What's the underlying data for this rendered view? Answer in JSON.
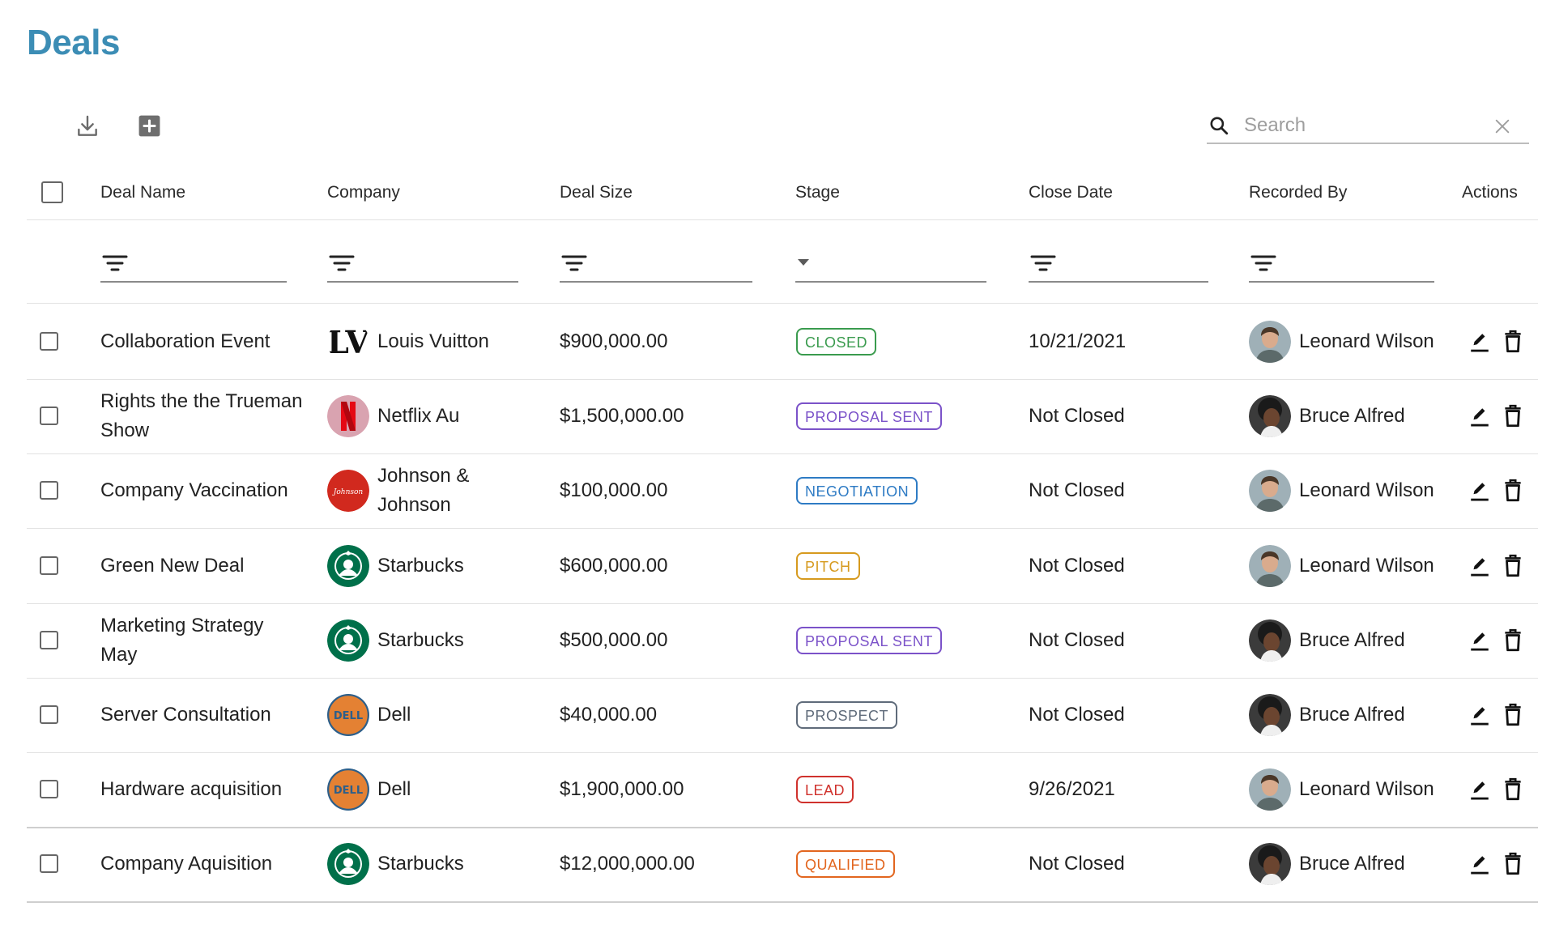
{
  "page": {
    "title": "Deals"
  },
  "toolbar": {
    "download_icon": "download-icon",
    "add_icon": "add-box-icon"
  },
  "search": {
    "placeholder": "Search",
    "value": "",
    "search_icon": "search-icon",
    "clear_icon": "close-icon"
  },
  "table": {
    "columns": [
      "Deal Name",
      "Company",
      "Deal Size",
      "Stage",
      "Close Date",
      "Recorded By",
      "Actions"
    ],
    "rows": [
      {
        "deal_name": "Collaboration Event",
        "company": "Louis Vuitton",
        "logo": "louis-vuitton-logo",
        "deal_size": "$900,000.00",
        "stage": "CLOSED",
        "stage_color": "#3a9b4e",
        "close_date": "10/21/2021",
        "recorded_by": "Leonard Wilson",
        "avatar": "leonard-avatar"
      },
      {
        "deal_name": "Rights the the Trueman Show",
        "company": "Netflix Au",
        "logo": "netflix-logo",
        "deal_size": "$1,500,000.00",
        "stage": "PROPOSAL SENT",
        "stage_color": "#7b52c9",
        "close_date": "Not Closed",
        "recorded_by": "Bruce Alfred",
        "avatar": "bruce-avatar"
      },
      {
        "deal_name": "Company Vaccination",
        "company": "Johnson & Johnson",
        "logo": "johnson-logo",
        "deal_size": "$100,000.00",
        "stage": "NEGOTIATION",
        "stage_color": "#2e7bc4",
        "close_date": "Not Closed",
        "recorded_by": "Leonard Wilson",
        "avatar": "leonard-avatar"
      },
      {
        "deal_name": "Green New Deal",
        "company": "Starbucks",
        "logo": "starbucks-logo",
        "deal_size": "$600,000.00",
        "stage": "PITCH",
        "stage_color": "#d69a1e",
        "close_date": "Not Closed",
        "recorded_by": "Leonard Wilson",
        "avatar": "leonard-avatar"
      },
      {
        "deal_name": "Marketing Strategy May",
        "company": "Starbucks",
        "logo": "starbucks-logo",
        "deal_size": "$500,000.00",
        "stage": "PROPOSAL SENT",
        "stage_color": "#7b52c9",
        "close_date": "Not Closed",
        "recorded_by": "Bruce Alfred",
        "avatar": "bruce-avatar"
      },
      {
        "deal_name": "Server Consultation",
        "company": "Dell",
        "logo": "dell-logo",
        "deal_size": "$40,000.00",
        "stage": "PROSPECT",
        "stage_color": "#5f6b7a",
        "close_date": "Not Closed",
        "recorded_by": "Bruce Alfred",
        "avatar": "bruce-avatar"
      },
      {
        "deal_name": "Hardware acquisition",
        "company": "Dell",
        "logo": "dell-logo",
        "deal_size": "$1,900,000.00",
        "stage": "LEAD",
        "stage_color": "#d0322d",
        "close_date": "9/26/2021",
        "recorded_by": "Leonard Wilson",
        "avatar": "leonard-avatar"
      },
      {
        "deal_name": "Company Aquisition",
        "company": "Starbucks",
        "logo": "starbucks-logo",
        "deal_size": "$12,000,000.00",
        "stage": "QUALIFIED",
        "stage_color": "#e2661f",
        "close_date": "Not Closed",
        "recorded_by": "Bruce Alfred",
        "avatar": "bruce-avatar"
      }
    ]
  },
  "icons": {
    "filter": "filter-icon",
    "stage_dropdown": "chevron-down-icon",
    "edit": "pencil-icon",
    "delete": "trash-icon"
  }
}
